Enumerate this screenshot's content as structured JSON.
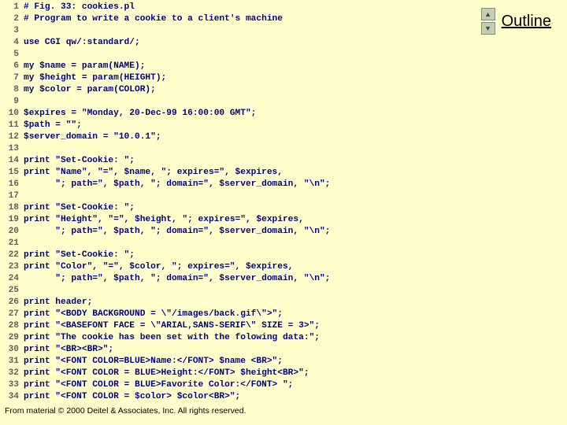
{
  "outline": {
    "label": "Outline",
    "up": "▲",
    "down": "▼"
  },
  "footer": "From material © 2000 Deitel & Associates, Inc.  All rights reserved.",
  "code": [
    "# Fig. 33: cookies.pl",
    "# Program to write a cookie to a client's machine",
    "",
    "use CGI qw/:standard/;",
    "",
    "my $name = param(NAME);",
    "my $height = param(HEIGHT);",
    "my $color = param(COLOR);",
    "",
    "$expires = \"Monday, 20-Dec-99 16:00:00 GMT\";",
    "$path = \"\";",
    "$server_domain = \"10.0.1\";",
    "",
    "print \"Set-Cookie: \";",
    "print \"Name\", \"=\", $name, \"; expires=\", $expires,",
    "      \"; path=\", $path, \"; domain=\", $server_domain, \"\\n\";",
    "",
    "print \"Set-Cookie: \";",
    "print \"Height\", \"=\", $height, \"; expires=\", $expires,",
    "      \"; path=\", $path, \"; domain=\", $server_domain, \"\\n\";",
    "",
    "print \"Set-Cookie: \";",
    "print \"Color\", \"=\", $color, \"; expires=\", $expires,",
    "      \"; path=\", $path, \"; domain=\", $server_domain, \"\\n\";",
    "",
    "print header;",
    "print \"<BODY BACKGROUND = \\\"/images/back.gif\\\">\";",
    "print \"<BASEFONT FACE = \\\"ARIAL,SANS-SERIF\\\" SIZE = 3>\";",
    "print \"The cookie has been set with the folowing data:\";",
    "print \"<BR><BR>\";",
    "print \"<FONT COLOR=BLUE>Name:</FONT> $name <BR>\";",
    "print \"<FONT COLOR = BLUE>Height:</FONT> $height<BR>\";",
    "print \"<FONT COLOR = BLUE>Favorite Color:</FONT> \";",
    "print \"<FONT COLOR = $color> $color<BR>\";"
  ]
}
